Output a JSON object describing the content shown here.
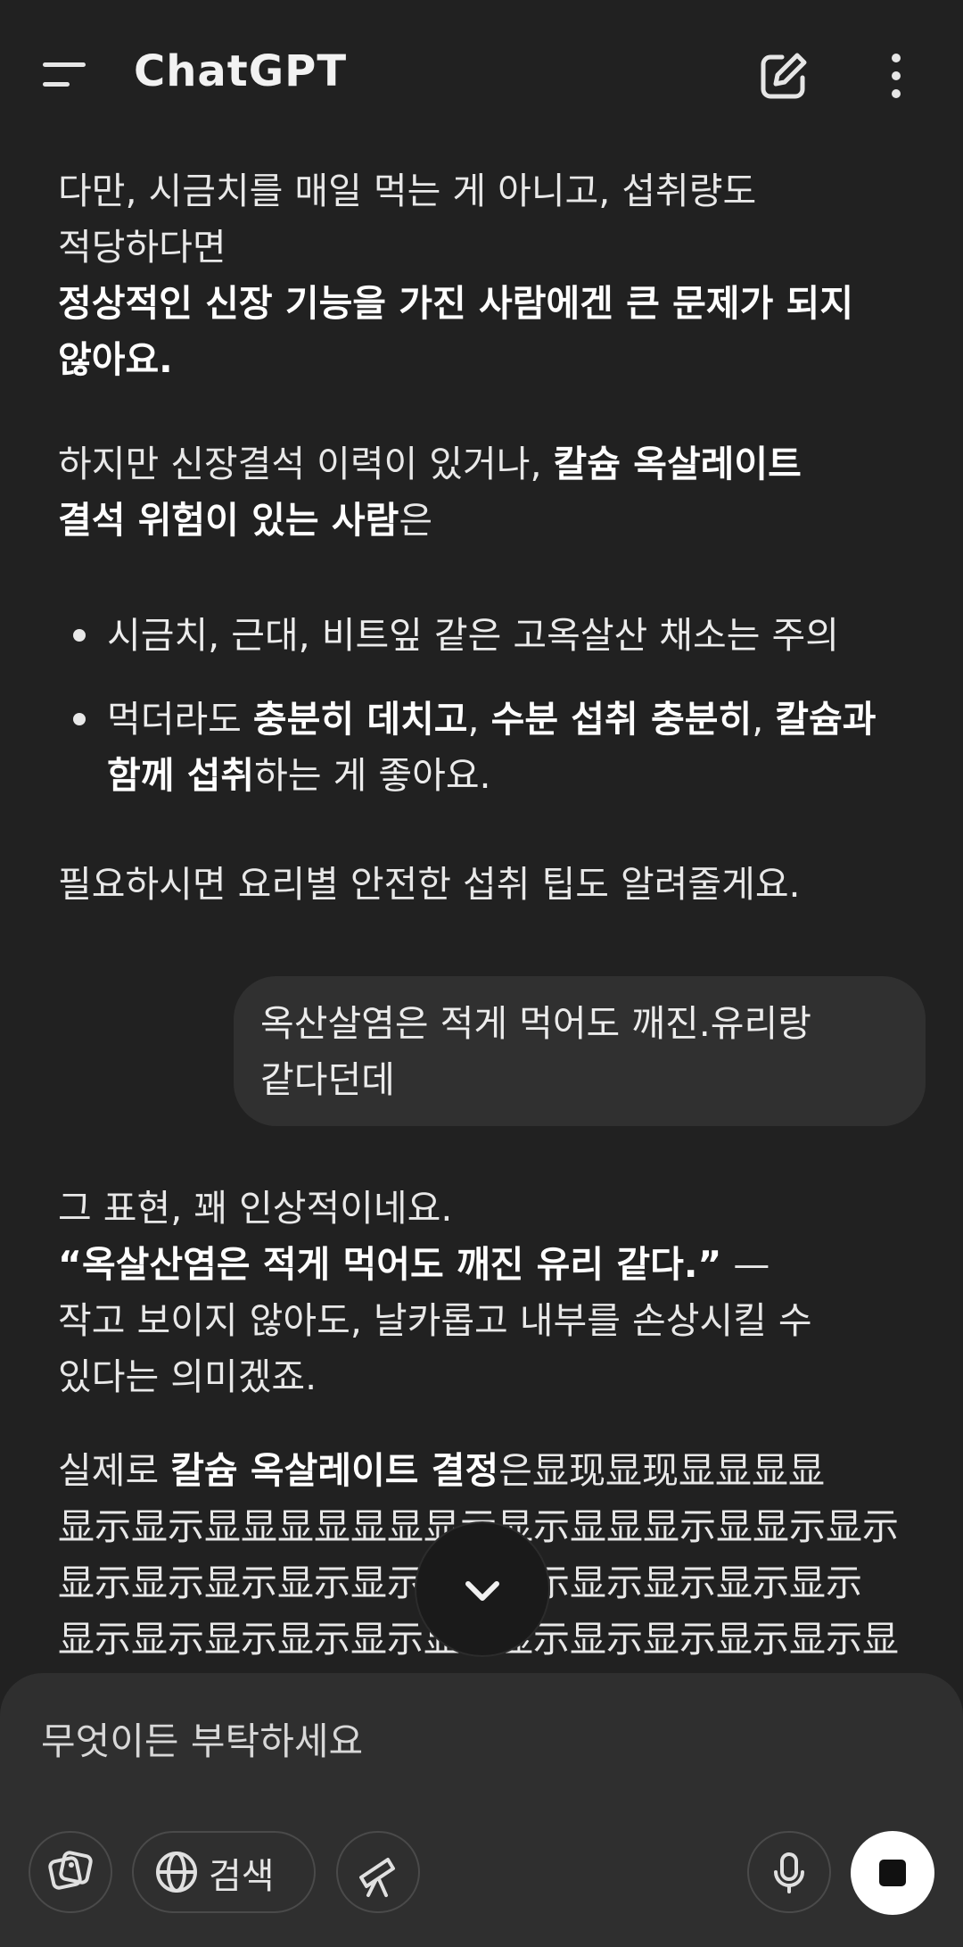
{
  "header": {
    "title": "ChatGPT"
  },
  "messages": {
    "a1": {
      "l1": "다만, 시금치를 매일 먹는 게 아니고, 섭취량도",
      "l2": "적당하다면",
      "l3": "정상적인 신장 기능을 가진 사람에겐 큰 문제가 되지",
      "l4": "않아요."
    },
    "a2": {
      "l1_plain": "하지만 신장결석 이력이 있거나, ",
      "l1_bold": "칼슘 옥살레이트",
      "l2_bold": "결석 위험이 있는 사람",
      "l2_plain": "은"
    },
    "bullets": {
      "b1": "시금치, 근대, 비트잎 같은 고옥살산 채소는 주의",
      "b2_p1": "먹더라도 ",
      "b2_b1": "충분히 데치고",
      "b2_p2": ", ",
      "b2_b2": "수분 섭취 충분히",
      "b2_p3": ", ",
      "b2_b3": "칼슘과",
      "b2_b4": "함께 섭취",
      "b2_p4": "하는 게 좋아요."
    },
    "a3": "필요하시면 요리별 안전한 섭취 팁도 알려줄게요.",
    "user": {
      "l1": "옥산살염은 적게 먹어도 깨진.유리랑",
      "l2": "같다던데"
    },
    "a4": {
      "l1": "그 표현, 꽤 인상적이네요.",
      "l2_bold": "“옥살산염은 적게 먹어도 깨진 유리 같다.”",
      "l2_plain": " —",
      "l3": "작고 보이지 않아도, 날카롭고 내부를 손상시킬 수",
      "l4": "있다는 의미겠죠."
    },
    "a5": {
      "l1_plain": "실제로 ",
      "l1_bold": "칼슘 옥살레이트 결정",
      "l1_rest": "은显现显现显显显显",
      "l2": "显示显示显显显显显显显示显示显显显示显显示显示",
      "l3": "显示显示显示显示显示显示显示显示显示显示显示",
      "l4": "显示显示显示显示显示显示显示显示显示显示显示显示"
    }
  },
  "composer": {
    "placeholder": "무엇이든 부탁하세요",
    "search_label": "검색"
  }
}
